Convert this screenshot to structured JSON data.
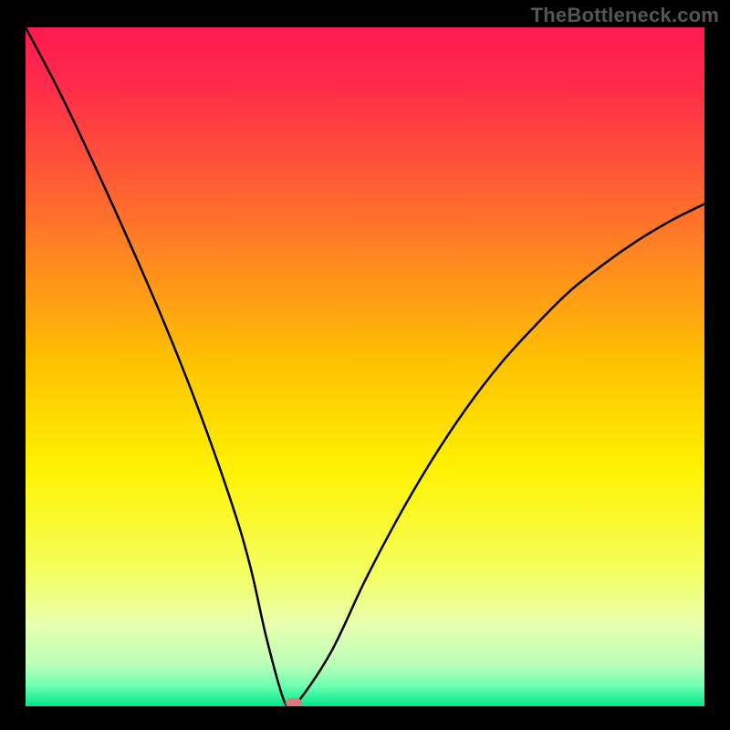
{
  "watermark": "TheBottleneck.com",
  "chart_data": {
    "type": "line",
    "title": "",
    "xlabel": "",
    "ylabel": "",
    "xlim": [
      0,
      100
    ],
    "ylim": [
      0,
      100
    ],
    "grid": false,
    "x": [
      0,
      5,
      10,
      15,
      20,
      25,
      30,
      33,
      35.5,
      38,
      39,
      40,
      45,
      50,
      55,
      60,
      65,
      70,
      75,
      80,
      85,
      90,
      95,
      100
    ],
    "y": [
      100,
      90.5,
      80,
      69,
      57.5,
      45,
      31,
      21,
      10,
      1,
      0.5,
      0.5,
      8,
      18.5,
      28,
      36.5,
      44,
      50.5,
      56,
      61,
      65,
      68.5,
      71.5,
      74
    ],
    "marker": {
      "x": 39.5,
      "y": 0.5,
      "color": "#d97b7b"
    },
    "background_gradient": {
      "stops": [
        {
          "offset": 0.0,
          "color": "#ff1a4f"
        },
        {
          "offset": 0.08,
          "color": "#ff2a4a"
        },
        {
          "offset": 0.2,
          "color": "#ff5238"
        },
        {
          "offset": 0.35,
          "color": "#ff8c1e"
        },
        {
          "offset": 0.5,
          "color": "#ffc400"
        },
        {
          "offset": 0.65,
          "color": "#fff200"
        },
        {
          "offset": 0.8,
          "color": "#f5ff5e"
        },
        {
          "offset": 0.88,
          "color": "#e8ffb0"
        },
        {
          "offset": 0.94,
          "color": "#b8ffb8"
        },
        {
          "offset": 0.97,
          "color": "#6effb0"
        },
        {
          "offset": 1.0,
          "color": "#00e68c"
        }
      ]
    },
    "line_color": "#000000",
    "line_width": 2.5
  }
}
